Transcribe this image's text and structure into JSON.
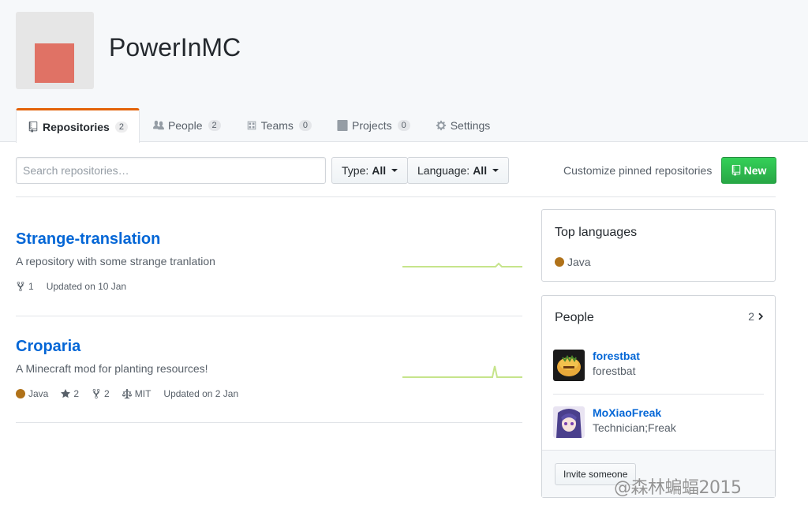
{
  "org": {
    "name": "PowerInMC",
    "avatar_color": "#e07265"
  },
  "tabs": [
    {
      "label": "Repositories",
      "count": "2",
      "icon": "repo-icon"
    },
    {
      "label": "People",
      "count": "2",
      "icon": "people-icon"
    },
    {
      "label": "Teams",
      "count": "0",
      "icon": "teams-icon"
    },
    {
      "label": "Projects",
      "count": "0",
      "icon": "project-icon"
    },
    {
      "label": "Settings",
      "icon": "gear-icon"
    }
  ],
  "toolbar": {
    "search_placeholder": "Search repositories…",
    "type_label": "Type:",
    "type_value": "All",
    "language_label": "Language:",
    "language_value": "All",
    "customize_label": "Customize pinned repositories",
    "new_label": "New"
  },
  "repos": [
    {
      "name": "Strange-translation",
      "description": "A repository with some strange tranlation",
      "forks": "1",
      "updated": "Updated on 10 Jan"
    },
    {
      "name": "Croparia",
      "description": "A Minecraft mod for planting resources!",
      "language": "Java",
      "stars": "2",
      "forks": "2",
      "license": "MIT",
      "updated": "Updated on 2 Jan"
    }
  ],
  "top_languages": {
    "title": "Top languages",
    "items": [
      {
        "name": "Java",
        "color": "#b07219"
      }
    ]
  },
  "people": {
    "title": "People",
    "count": "2",
    "members": [
      {
        "login": "forestbat",
        "name": "forestbat"
      },
      {
        "login": "MoXiaoFreak",
        "name": "Technician;Freak"
      }
    ],
    "invite_label": "Invite someone"
  },
  "watermark": "@森林蝙蝠2015",
  "colors": {
    "accent": "#e36209",
    "link": "#0366d6",
    "new_button": "#28a745",
    "java": "#b07219"
  }
}
